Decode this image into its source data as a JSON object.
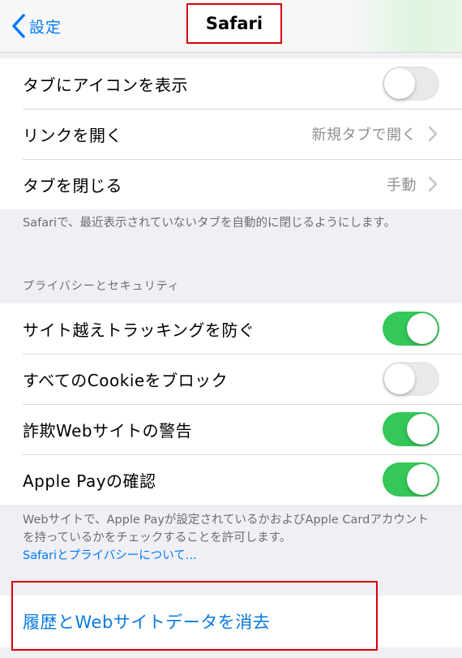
{
  "navbar": {
    "back_label": "設定",
    "title": "Safari"
  },
  "tabs_group": {
    "rows": [
      {
        "label": "タブにアイコンを表示",
        "toggle": false
      },
      {
        "label": "リンクを開く",
        "value": "新規タブで開く"
      },
      {
        "label": "タブを閉じる",
        "value": "手動"
      }
    ],
    "footer": "Safariで、最近表示されていないタブを自動的に閉じるようにします。"
  },
  "privacy_group": {
    "header": "プライバシーとセキュリティ",
    "rows": [
      {
        "label": "サイト越えトラッキングを防ぐ",
        "toggle": true
      },
      {
        "label": "すべてのCookieをブロック",
        "toggle": false
      },
      {
        "label": "詐欺Webサイトの警告",
        "toggle": true
      },
      {
        "label": "Apple Payの確認",
        "toggle": true
      }
    ],
    "footer": "Webサイトで、Apple Payが設定されているかおよびApple Cardアカウントを持っているかをチェックすることを許可します。",
    "footer_link": "Safariとプライバシーについて..."
  },
  "clear_group": {
    "label": "履歴とWebサイトデータを消去"
  },
  "colors": {
    "accent": "#007aff",
    "toggle_on": "#34c759",
    "highlight": "#d8000c"
  }
}
